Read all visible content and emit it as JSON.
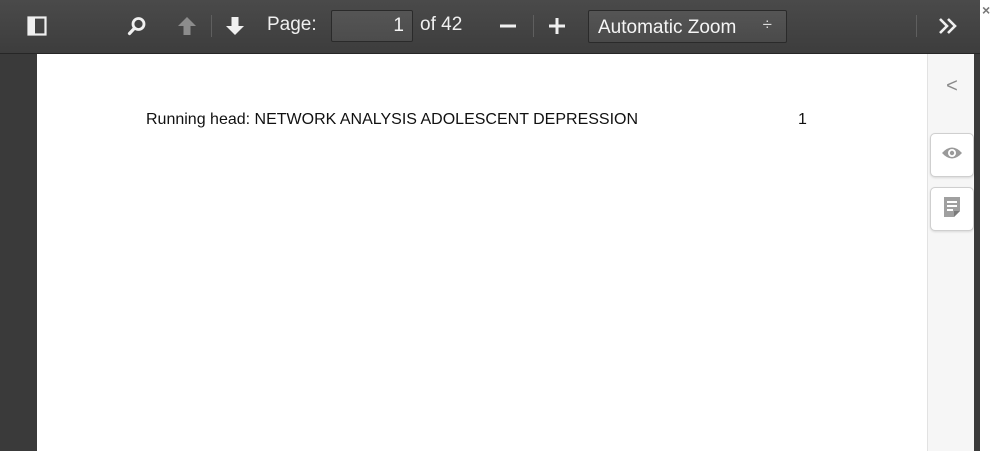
{
  "toolbar": {
    "sidebar_toggle_icon": "sidebar-toggle-icon",
    "search_icon": "search-icon",
    "prev_icon": "arrow-up-icon",
    "next_icon": "arrow-down-icon",
    "page_label": "Page:",
    "page_value": "1",
    "page_count": "of 42",
    "zoom_out_icon": "minus-icon",
    "zoom_in_icon": "plus-icon",
    "zoom_value": "Automatic Zoom",
    "zoom_caret": "÷",
    "tools_icon": "double-chevron-right-icon"
  },
  "document": {
    "running_head": "Running head: NETWORK ANALYSIS ADOLESCENT DEPRESSION",
    "page_number": "1"
  },
  "side_panel": {
    "collapse_glyph": "<",
    "tools": [
      "eye-icon",
      "notes-icon"
    ]
  },
  "colors": {
    "toolbar": "#434343",
    "viewer_bg": "#3a3a3a",
    "page": "#ffffff",
    "side_panel": "#f6f6f6"
  }
}
